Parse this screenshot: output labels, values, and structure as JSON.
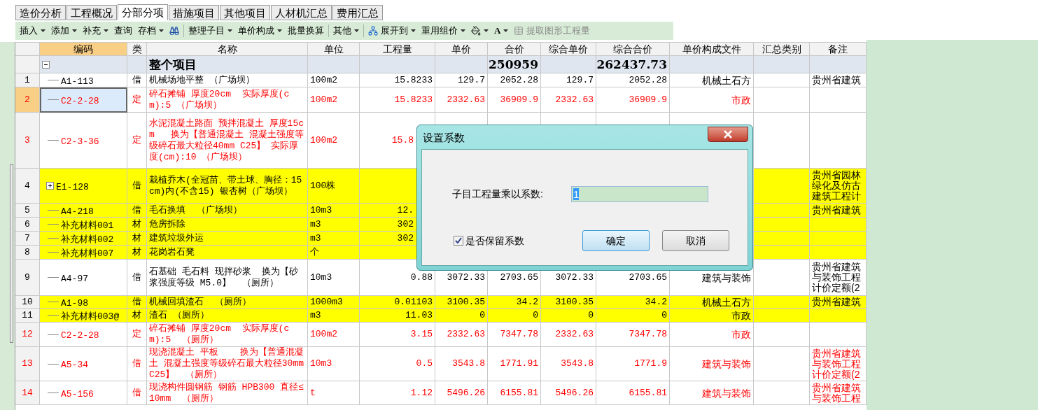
{
  "tabs": [
    {
      "label": "造价分析",
      "selected": false
    },
    {
      "label": "工程概况",
      "selected": false
    },
    {
      "label": "分部分项",
      "selected": true
    },
    {
      "label": "措施项目",
      "selected": false
    },
    {
      "label": "其他项目",
      "selected": false
    },
    {
      "label": "人材机汇总",
      "selected": false
    },
    {
      "label": "费用汇总",
      "selected": false
    }
  ],
  "toolbar": [
    [
      {
        "kind": "menu",
        "label": "插入",
        "disabled": false
      },
      {
        "kind": "menu",
        "label": "添加",
        "disabled": false
      },
      {
        "kind": "menu",
        "label": "补充",
        "disabled": false
      },
      {
        "kind": "button",
        "label": "查询",
        "disabled": false
      },
      {
        "kind": "menu",
        "label": "存档",
        "disabled": false
      },
      {
        "kind": "find",
        "disabled": false
      }
    ],
    [
      {
        "kind": "menu",
        "label": "整理子目",
        "disabled": false
      },
      {
        "kind": "menu",
        "label": "单价构成",
        "disabled": false
      },
      {
        "kind": "button",
        "label": "批量换算",
        "disabled": false
      }
    ],
    [
      {
        "kind": "menu",
        "label": "其他",
        "disabled": false
      }
    ],
    [
      {
        "kind": "expand",
        "label": "展开到",
        "disabled": false
      },
      {
        "kind": "menu",
        "label": "重用组价",
        "disabled": false
      },
      {
        "kind": "fill",
        "disabled": false
      },
      {
        "kind": "font",
        "label": "A",
        "disabled": false
      },
      {
        "kind": "extract",
        "label": "提取图形工程量",
        "disabled": true
      }
    ]
  ],
  "table": {
    "columns": [
      {
        "selected": false
      },
      {
        "label": "编码",
        "selected": true
      },
      {
        "label": "类",
        "selected": false
      },
      {
        "label": "名称",
        "selected": false
      },
      {
        "label": "单位",
        "selected": false
      },
      {
        "label": "工程量",
        "selected": false
      },
      {
        "label": "单价",
        "selected": false
      },
      {
        "label": "合价",
        "selected": false
      },
      {
        "label": "综合单价",
        "selected": false
      },
      {
        "label": "综合合价",
        "selected": false
      },
      {
        "label": "单价构成文件",
        "selected": false
      },
      {
        "label": "汇总类别",
        "selected": false
      },
      {
        "label": "备注",
        "selected": false
      }
    ],
    "total_row": {
      "expanded": true,
      "name": "整个项目",
      "total": "250959",
      "comp_total": "262437.73"
    },
    "rows": [
      {
        "num": "1",
        "kind": "leaf",
        "code": "A1-113",
        "type": "借",
        "name": "机械场地平整 （广场坝）",
        "unit": "100m2",
        "qty": "15.8233",
        "price": "129.7",
        "total": "2052.28",
        "unit_total": "129.7",
        "comp_total": "2052.28",
        "file": "机械土石方",
        "note": "贵州省建筑",
        "color": "#000000",
        "highlighted": false,
        "selected": false
      },
      {
        "num": "2",
        "kind": "leaf",
        "code": "C2-2-28",
        "type": "定",
        "name": "碎石摊铺 厚度20cm  实际厚度(cm):5 （广场坝）",
        "unit": "100m2",
        "qty": "15.8233",
        "price": "2332.63",
        "total": "36909.9",
        "unit_total": "2332.63",
        "comp_total": "36909.9",
        "file": "市政",
        "color": "#ff0000",
        "highlighted": false,
        "selected": true
      },
      {
        "num": "3",
        "kind": "leaf",
        "code": "C2-3-36",
        "type": "定",
        "name": "水泥混凝土路面 预拌混凝土 厚度15cm   换为【普通混凝土 混凝土强度等级碎石最大粒径40mm C25】 实际厚度(cm):10 （广场坝）",
        "unit": "100m2",
        "qty_partial": "15.8",
        "color": "#ff0000",
        "highlighted": false,
        "selected": false
      },
      {
        "num": "4",
        "kind": "group",
        "code": "E1-128",
        "type": "借",
        "name": "栽植乔木(全冠苗、带土球、胸径：15cm)内(不含15) 银杏树（广场坝）",
        "unit": "100株",
        "note": "贵州省园林绿化及仿古建筑工程计",
        "color": "#000000",
        "highlighted": true,
        "selected": false
      },
      {
        "num": "5",
        "kind": "leaf",
        "code": "A4-218",
        "type": "借",
        "name": "毛石换填  （广场坝）",
        "unit": "10m3",
        "qty_partial": "12.",
        "note": "贵州省建筑",
        "color": "#000000",
        "highlighted": true,
        "selected": false
      },
      {
        "num": "6",
        "kind": "leaf",
        "code": "补充材料001",
        "type": "材",
        "name": "危房拆除",
        "unit": "m3",
        "qty_partial": "302",
        "color": "#000000",
        "highlighted": true,
        "selected": false
      },
      {
        "num": "7",
        "kind": "leaf",
        "code": "补充材料002",
        "type": "材",
        "name": "建筑垃圾外运",
        "unit": "m3",
        "qty_partial": "302",
        "color": "#000000",
        "highlighted": true,
        "selected": false
      },
      {
        "num": "8",
        "kind": "leaf",
        "code": "补充材料007",
        "type": "材",
        "name": "花岗岩石凳",
        "unit": "个",
        "color": "#000000",
        "highlighted": true,
        "selected": false
      },
      {
        "num": "9",
        "kind": "leaf",
        "code": "A4-97",
        "type": "借",
        "name": "石基础 毛石料 现拌砂浆  换为【砂浆强度等级 M5.0】  （厕所）",
        "unit": "10m3",
        "qty": "0.88",
        "price": "3072.33",
        "total": "2703.65",
        "unit_total": "3072.33",
        "comp_total": "2703.65",
        "file": "建筑与装饰",
        "note": "贵州省建筑与装饰工程计价定额(2",
        "color": "#000000",
        "highlighted": false,
        "selected": false
      },
      {
        "num": "10",
        "kind": "leaf",
        "code": "A1-98",
        "type": "借",
        "name": "机械回填渣石  （厕所）",
        "unit": "1000m3",
        "qty": "0.01103",
        "price": "3100.35",
        "total": "34.2",
        "unit_total": "3100.35",
        "comp_total": "34.2",
        "file": "机械土石方",
        "note": "贵州省建筑",
        "color": "#000000",
        "highlighted": true,
        "selected": false
      },
      {
        "num": "11",
        "kind": "leaf",
        "code": "补充材料003@",
        "type": "材",
        "name": "渣石 （厕所）",
        "unit": "m3",
        "qty": "11.03",
        "price": "0",
        "total": "0",
        "unit_total": "0",
        "comp_total": "0",
        "file": "市政",
        "color": "#000000",
        "highlighted": true,
        "selected": false
      },
      {
        "num": "12",
        "kind": "leaf",
        "code": "C2-2-28",
        "type": "定",
        "name": "碎石摊铺 厚度20cm  实际厚度(cm):5  （厕所）",
        "unit": "100m2",
        "qty": "3.15",
        "price": "2332.63",
        "total": "7347.78",
        "unit_total": "2332.63",
        "comp_total": "7347.78",
        "file": "市政",
        "color": "#ff0000",
        "highlighted": false,
        "selected": false
      },
      {
        "num": "13",
        "kind": "leaf",
        "code": "A5-34",
        "type": "借",
        "name": "现浇混凝土 平板    换为【普通混凝土 混凝土强度等级碎石最大粒径30mm C25】  （厕所）",
        "unit": "10m3",
        "qty": "0.5",
        "price": "3543.8",
        "total": "1771.91",
        "unit_total": "3543.8",
        "comp_total": "1771.9",
        "file": "建筑与装饰",
        "note": "贵州省建筑与装饰工程计价定额(2",
        "color": "#ff0000",
        "highlighted": false,
        "selected": false
      },
      {
        "num": "14",
        "kind": "leaf",
        "code": "A5-156",
        "type": "借",
        "name": "现浇构件圆钢筋 钢筋 HPB300 直径≤10mm  （厕所）",
        "unit": "t",
        "qty": "1.12",
        "price": "5496.26",
        "total": "6155.81",
        "unit_total": "5496.26",
        "comp_total": "6155.81",
        "file": "建筑与装饰",
        "note": "贵州省建筑与装饰工程",
        "color": "#ff0000",
        "highlighted": false,
        "selected": false
      }
    ]
  },
  "dialog": {
    "title": "设置系数",
    "field_label": "子目工程量乘以系数:",
    "value": "1",
    "value_selected": true,
    "checkbox": {
      "label": "是否保留系数",
      "checked": true
    },
    "buttons": [
      {
        "label": "确定",
        "default": true
      },
      {
        "label": "取消",
        "default": false
      }
    ]
  }
}
